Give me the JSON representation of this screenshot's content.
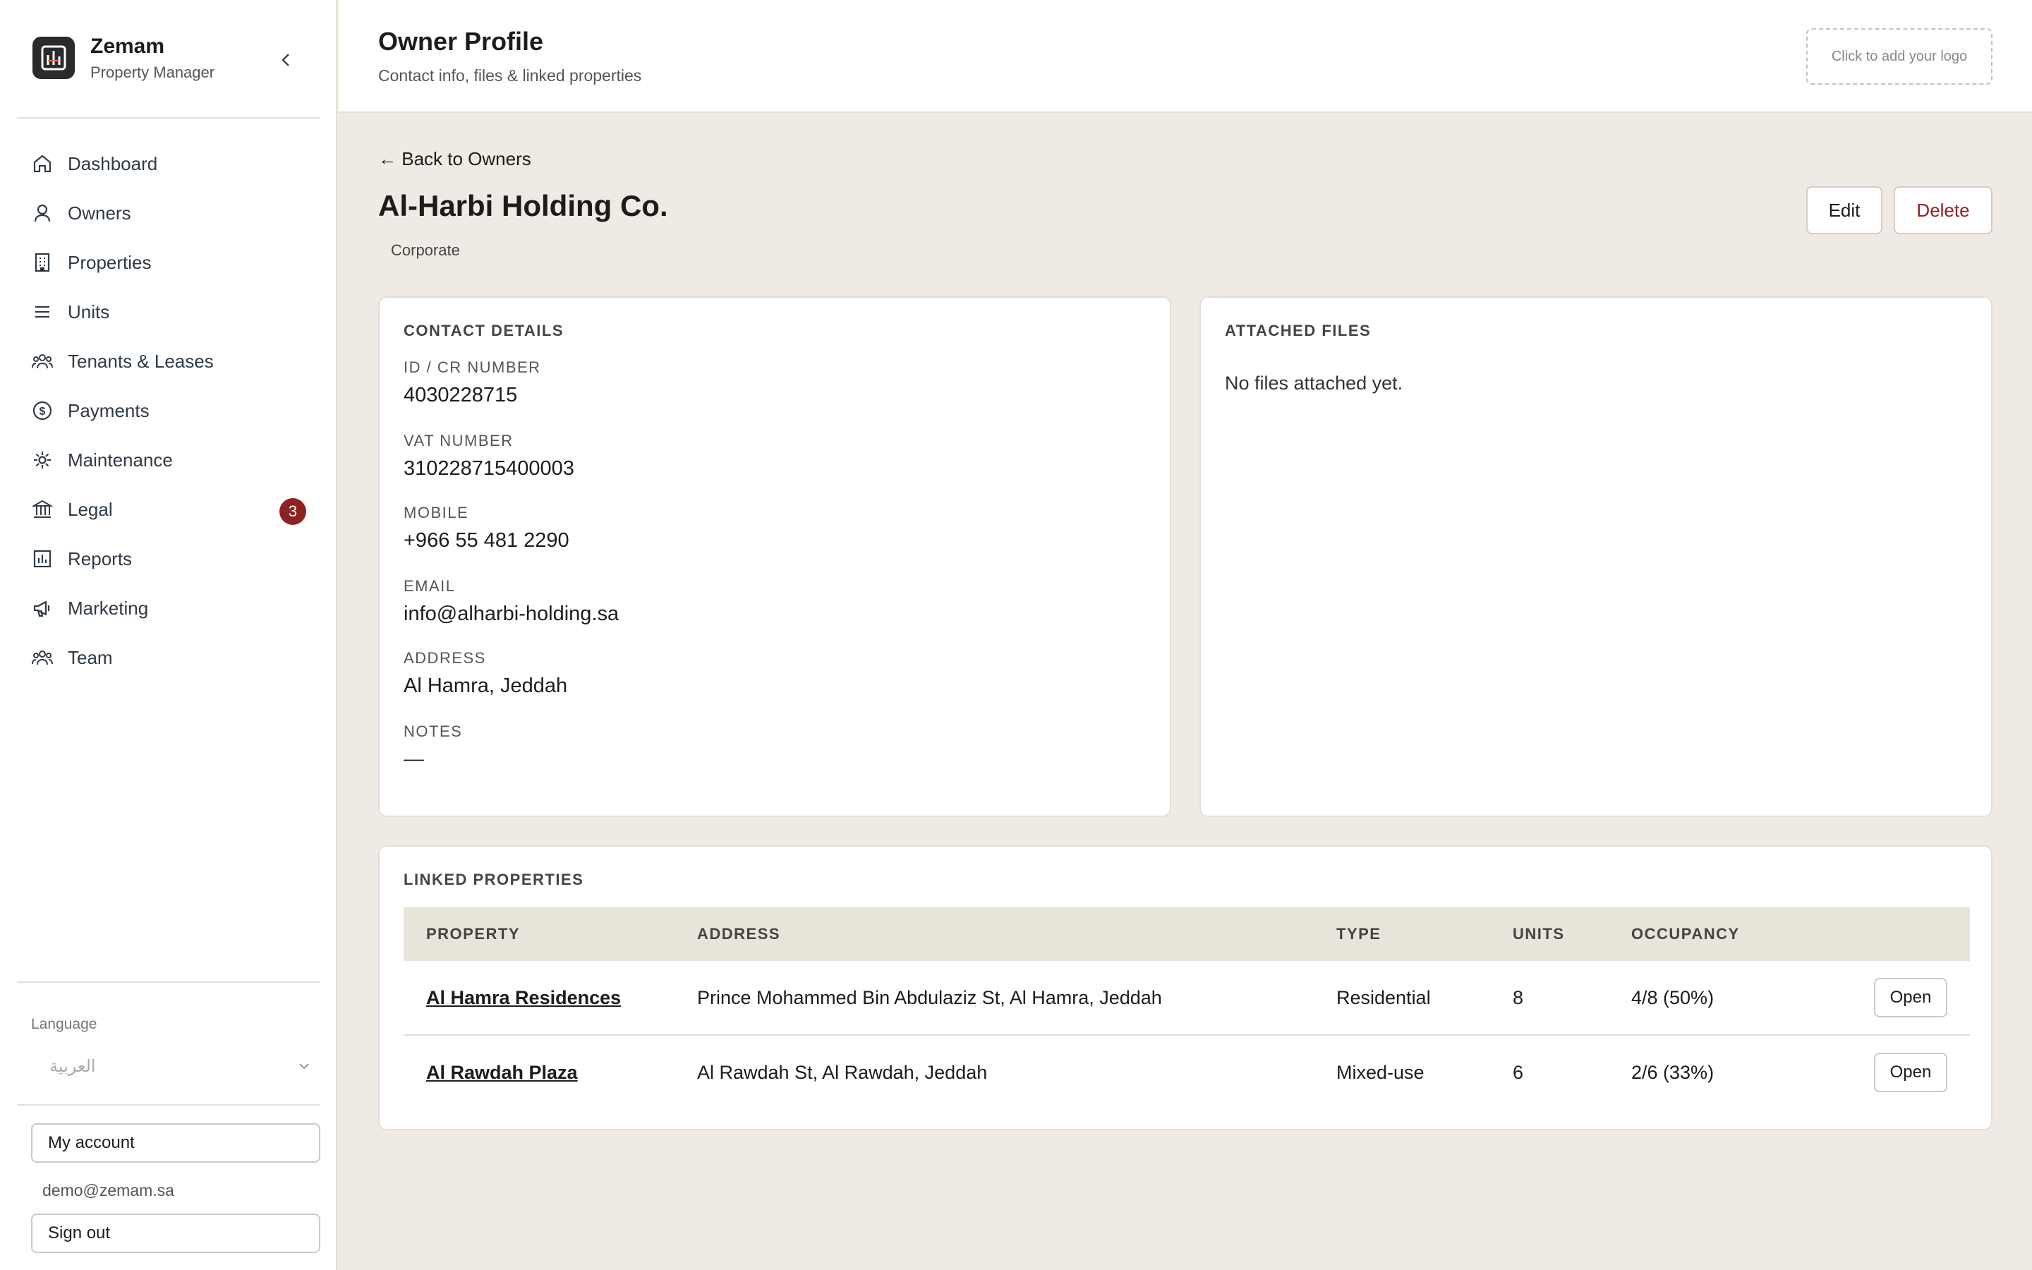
{
  "brand": {
    "name": "Zemam",
    "subtitle": "Property Manager"
  },
  "nav": [
    {
      "label": "Dashboard",
      "icon": "home-icon"
    },
    {
      "label": "Owners",
      "icon": "user-icon"
    },
    {
      "label": "Properties",
      "icon": "building-icon"
    },
    {
      "label": "Units",
      "icon": "list-icon"
    },
    {
      "label": "Tenants & Leases",
      "icon": "users-icon"
    },
    {
      "label": "Payments",
      "icon": "dollar-icon"
    },
    {
      "label": "Maintenance",
      "icon": "gear-icon"
    },
    {
      "label": "Legal",
      "icon": "bank-icon",
      "badge": "3"
    },
    {
      "label": "Reports",
      "icon": "chart-icon"
    },
    {
      "label": "Marketing",
      "icon": "megaphone-icon"
    },
    {
      "label": "Team",
      "icon": "team-icon"
    }
  ],
  "language": {
    "label": "Language",
    "value": "العربية"
  },
  "account": {
    "my_account": "My account",
    "email": "demo@zemam.sa",
    "sign_out": "Sign out"
  },
  "header": {
    "title": "Owner Profile",
    "subtitle": "Contact info, files & linked properties",
    "logo_placeholder": "Click to add your logo"
  },
  "owner": {
    "back": "← Back to Owners",
    "name": "Al-Harbi Holding Co.",
    "type": "Corporate",
    "edit": "Edit",
    "delete": "Delete"
  },
  "contact": {
    "title": "CONTACT DETAILS",
    "fields": [
      {
        "label": "ID / CR NUMBER",
        "value": "4030228715"
      },
      {
        "label": "VAT NUMBER",
        "value": "310228715400003"
      },
      {
        "label": "MOBILE",
        "value": "+966 55 481 2290"
      },
      {
        "label": "EMAIL",
        "value": "info@alharbi-holding.sa"
      },
      {
        "label": "ADDRESS",
        "value": "Al Hamra, Jeddah"
      },
      {
        "label": "NOTES",
        "value": "—"
      }
    ]
  },
  "files": {
    "title": "ATTACHED FILES",
    "empty": "No files attached yet."
  },
  "linked": {
    "title": "LINKED PROPERTIES",
    "columns": [
      "PROPERTY",
      "ADDRESS",
      "TYPE",
      "UNITS",
      "OCCUPANCY",
      ""
    ],
    "rows": [
      {
        "property": "Al Hamra Residences",
        "address": "Prince Mohammed Bin Abdulaziz St, Al Hamra, Jeddah",
        "type": "Residential",
        "units": "8",
        "occupancy": "4/8 (50%)",
        "action": "Open"
      },
      {
        "property": "Al Rawdah Plaza",
        "address": "Al Rawdah St, Al Rawdah, Jeddah",
        "type": "Mixed-use",
        "units": "6",
        "occupancy": "2/6 (33%)",
        "action": "Open"
      }
    ]
  },
  "colors": {
    "accent_danger": "#8e2222",
    "background": "#efebe4",
    "table_header": "#e9e4da"
  }
}
